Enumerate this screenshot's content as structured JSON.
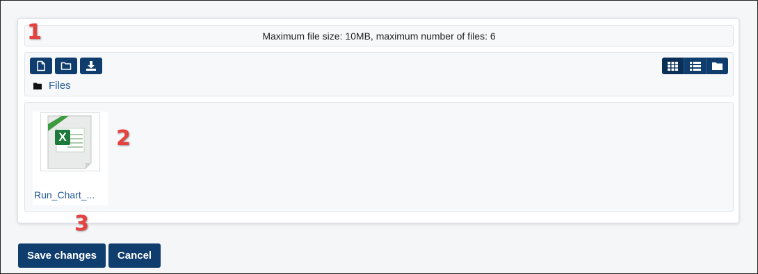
{
  "filepicker": {
    "limits_text": "Maximum file size: 10MB, maximum number of files: 6",
    "toolbar": {
      "buttons": [
        {
          "name": "add-file-button",
          "icon": "file-icon"
        },
        {
          "name": "create-folder-button",
          "icon": "folder-icon"
        },
        {
          "name": "download-all-button",
          "icon": "download-icon"
        }
      ],
      "view_modes": [
        {
          "name": "view-icons-button",
          "icon": "grid-icon",
          "active": true
        },
        {
          "name": "view-list-button",
          "icon": "list-icon",
          "active": false
        },
        {
          "name": "view-tree-button",
          "icon": "folder-icon",
          "active": false
        }
      ]
    },
    "breadcrumb": {
      "label": "Files",
      "icon": "folder-icon"
    },
    "files": [
      {
        "name": "Run_Chart_...",
        "icon": "excel-file-icon"
      }
    ]
  },
  "annotations": [
    "1",
    "2",
    "3"
  ],
  "actions": {
    "save_label": "Save changes",
    "cancel_label": "Cancel"
  },
  "colors": {
    "primary": "#0f3d6e",
    "link": "#1f5694",
    "annotation": "#e8403d",
    "excel_green": "#1e7a3a"
  }
}
